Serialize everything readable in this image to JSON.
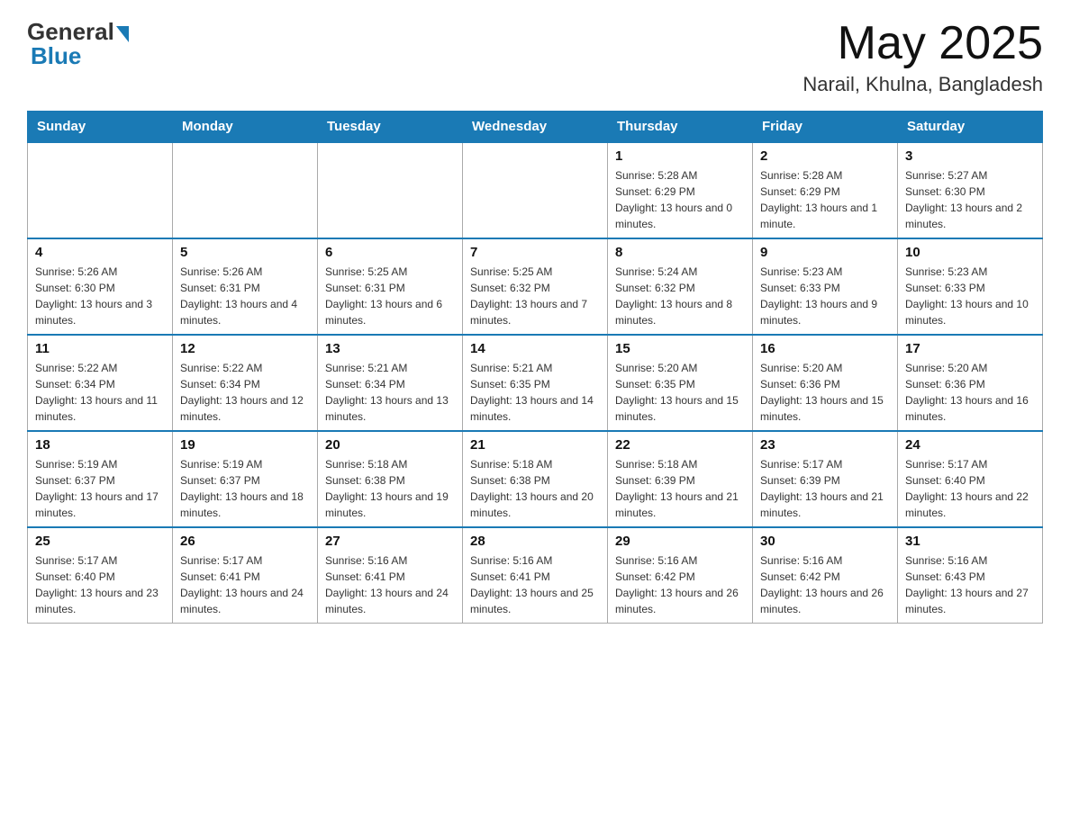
{
  "logo": {
    "general": "General",
    "blue": "Blue"
  },
  "title": {
    "month_year": "May 2025",
    "location": "Narail, Khulna, Bangladesh"
  },
  "days_of_week": [
    "Sunday",
    "Monday",
    "Tuesday",
    "Wednesday",
    "Thursday",
    "Friday",
    "Saturday"
  ],
  "weeks": [
    [
      {
        "day": "",
        "info": ""
      },
      {
        "day": "",
        "info": ""
      },
      {
        "day": "",
        "info": ""
      },
      {
        "day": "",
        "info": ""
      },
      {
        "day": "1",
        "info": "Sunrise: 5:28 AM\nSunset: 6:29 PM\nDaylight: 13 hours and 0 minutes."
      },
      {
        "day": "2",
        "info": "Sunrise: 5:28 AM\nSunset: 6:29 PM\nDaylight: 13 hours and 1 minute."
      },
      {
        "day": "3",
        "info": "Sunrise: 5:27 AM\nSunset: 6:30 PM\nDaylight: 13 hours and 2 minutes."
      }
    ],
    [
      {
        "day": "4",
        "info": "Sunrise: 5:26 AM\nSunset: 6:30 PM\nDaylight: 13 hours and 3 minutes."
      },
      {
        "day": "5",
        "info": "Sunrise: 5:26 AM\nSunset: 6:31 PM\nDaylight: 13 hours and 4 minutes."
      },
      {
        "day": "6",
        "info": "Sunrise: 5:25 AM\nSunset: 6:31 PM\nDaylight: 13 hours and 6 minutes."
      },
      {
        "day": "7",
        "info": "Sunrise: 5:25 AM\nSunset: 6:32 PM\nDaylight: 13 hours and 7 minutes."
      },
      {
        "day": "8",
        "info": "Sunrise: 5:24 AM\nSunset: 6:32 PM\nDaylight: 13 hours and 8 minutes."
      },
      {
        "day": "9",
        "info": "Sunrise: 5:23 AM\nSunset: 6:33 PM\nDaylight: 13 hours and 9 minutes."
      },
      {
        "day": "10",
        "info": "Sunrise: 5:23 AM\nSunset: 6:33 PM\nDaylight: 13 hours and 10 minutes."
      }
    ],
    [
      {
        "day": "11",
        "info": "Sunrise: 5:22 AM\nSunset: 6:34 PM\nDaylight: 13 hours and 11 minutes."
      },
      {
        "day": "12",
        "info": "Sunrise: 5:22 AM\nSunset: 6:34 PM\nDaylight: 13 hours and 12 minutes."
      },
      {
        "day": "13",
        "info": "Sunrise: 5:21 AM\nSunset: 6:34 PM\nDaylight: 13 hours and 13 minutes."
      },
      {
        "day": "14",
        "info": "Sunrise: 5:21 AM\nSunset: 6:35 PM\nDaylight: 13 hours and 14 minutes."
      },
      {
        "day": "15",
        "info": "Sunrise: 5:20 AM\nSunset: 6:35 PM\nDaylight: 13 hours and 15 minutes."
      },
      {
        "day": "16",
        "info": "Sunrise: 5:20 AM\nSunset: 6:36 PM\nDaylight: 13 hours and 15 minutes."
      },
      {
        "day": "17",
        "info": "Sunrise: 5:20 AM\nSunset: 6:36 PM\nDaylight: 13 hours and 16 minutes."
      }
    ],
    [
      {
        "day": "18",
        "info": "Sunrise: 5:19 AM\nSunset: 6:37 PM\nDaylight: 13 hours and 17 minutes."
      },
      {
        "day": "19",
        "info": "Sunrise: 5:19 AM\nSunset: 6:37 PM\nDaylight: 13 hours and 18 minutes."
      },
      {
        "day": "20",
        "info": "Sunrise: 5:18 AM\nSunset: 6:38 PM\nDaylight: 13 hours and 19 minutes."
      },
      {
        "day": "21",
        "info": "Sunrise: 5:18 AM\nSunset: 6:38 PM\nDaylight: 13 hours and 20 minutes."
      },
      {
        "day": "22",
        "info": "Sunrise: 5:18 AM\nSunset: 6:39 PM\nDaylight: 13 hours and 21 minutes."
      },
      {
        "day": "23",
        "info": "Sunrise: 5:17 AM\nSunset: 6:39 PM\nDaylight: 13 hours and 21 minutes."
      },
      {
        "day": "24",
        "info": "Sunrise: 5:17 AM\nSunset: 6:40 PM\nDaylight: 13 hours and 22 minutes."
      }
    ],
    [
      {
        "day": "25",
        "info": "Sunrise: 5:17 AM\nSunset: 6:40 PM\nDaylight: 13 hours and 23 minutes."
      },
      {
        "day": "26",
        "info": "Sunrise: 5:17 AM\nSunset: 6:41 PM\nDaylight: 13 hours and 24 minutes."
      },
      {
        "day": "27",
        "info": "Sunrise: 5:16 AM\nSunset: 6:41 PM\nDaylight: 13 hours and 24 minutes."
      },
      {
        "day": "28",
        "info": "Sunrise: 5:16 AM\nSunset: 6:41 PM\nDaylight: 13 hours and 25 minutes."
      },
      {
        "day": "29",
        "info": "Sunrise: 5:16 AM\nSunset: 6:42 PM\nDaylight: 13 hours and 26 minutes."
      },
      {
        "day": "30",
        "info": "Sunrise: 5:16 AM\nSunset: 6:42 PM\nDaylight: 13 hours and 26 minutes."
      },
      {
        "day": "31",
        "info": "Sunrise: 5:16 AM\nSunset: 6:43 PM\nDaylight: 13 hours and 27 minutes."
      }
    ]
  ]
}
